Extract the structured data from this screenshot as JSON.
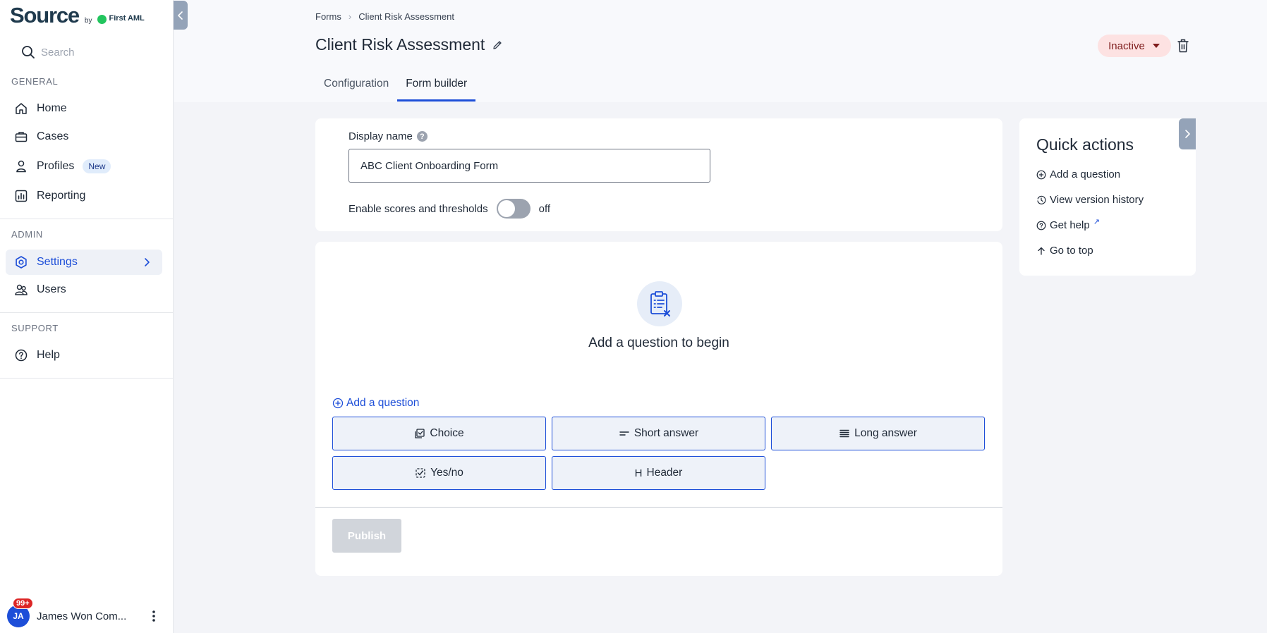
{
  "brand": {
    "name": "Source",
    "by": "by",
    "company": "First AML"
  },
  "search": {
    "placeholder": "Search"
  },
  "nav": {
    "general_label": "GENERAL",
    "general_items": [
      {
        "label": "Home",
        "icon": "home-icon"
      },
      {
        "label": "Cases",
        "icon": "briefcase-icon"
      },
      {
        "label": "Profiles",
        "icon": "person-icon",
        "badge": "New"
      },
      {
        "label": "Reporting",
        "icon": "chart-icon"
      }
    ],
    "admin_label": "ADMIN",
    "admin_items": [
      {
        "label": "Settings",
        "icon": "gear-icon",
        "active": true
      },
      {
        "label": "Users",
        "icon": "users-icon"
      }
    ],
    "support_label": "SUPPORT",
    "support_items": [
      {
        "label": "Help",
        "icon": "help-circle-icon"
      }
    ]
  },
  "user": {
    "initials": "JA",
    "name": "James Won Com...",
    "notifications": "99+"
  },
  "header": {
    "breadcrumb": [
      "Forms",
      "Client Risk Assessment"
    ],
    "title": "Client Risk Assessment",
    "status": "Inactive",
    "tabs": [
      {
        "label": "Configuration",
        "active": false
      },
      {
        "label": "Form builder",
        "active": true
      }
    ]
  },
  "form": {
    "display_name_label": "Display name",
    "help_glyph": "?",
    "display_name_value": "ABC Client Onboarding Form",
    "scores_label": "Enable scores and thresholds",
    "scores_state": "off"
  },
  "builder": {
    "empty_title": "Add a question to begin",
    "add_question": "Add a question",
    "question_types": [
      {
        "label": "Choice",
        "icon": "choice-icon"
      },
      {
        "label": "Short answer",
        "icon": "short-answer-icon"
      },
      {
        "label": "Long answer",
        "icon": "long-answer-icon"
      },
      {
        "label": "Yes/no",
        "icon": "yes-no-icon"
      },
      {
        "label": "Header",
        "icon": "header-icon",
        "glyph": "H"
      }
    ],
    "publish": "Publish"
  },
  "quick_actions": {
    "title": "Quick actions",
    "items": [
      {
        "label": "Add a question",
        "icon": "plus-circle-icon"
      },
      {
        "label": "View version history",
        "icon": "history-icon"
      },
      {
        "label": "Get help",
        "icon": "help-circle-icon",
        "external_glyph": "↗"
      },
      {
        "label": "Go to top",
        "icon": "arrow-up-icon"
      }
    ]
  },
  "colors": {
    "accent": "#1d4ed8",
    "status_bg": "#fde2e2",
    "status_text": "#7f1d1d",
    "badge_red": "#dc2626"
  }
}
